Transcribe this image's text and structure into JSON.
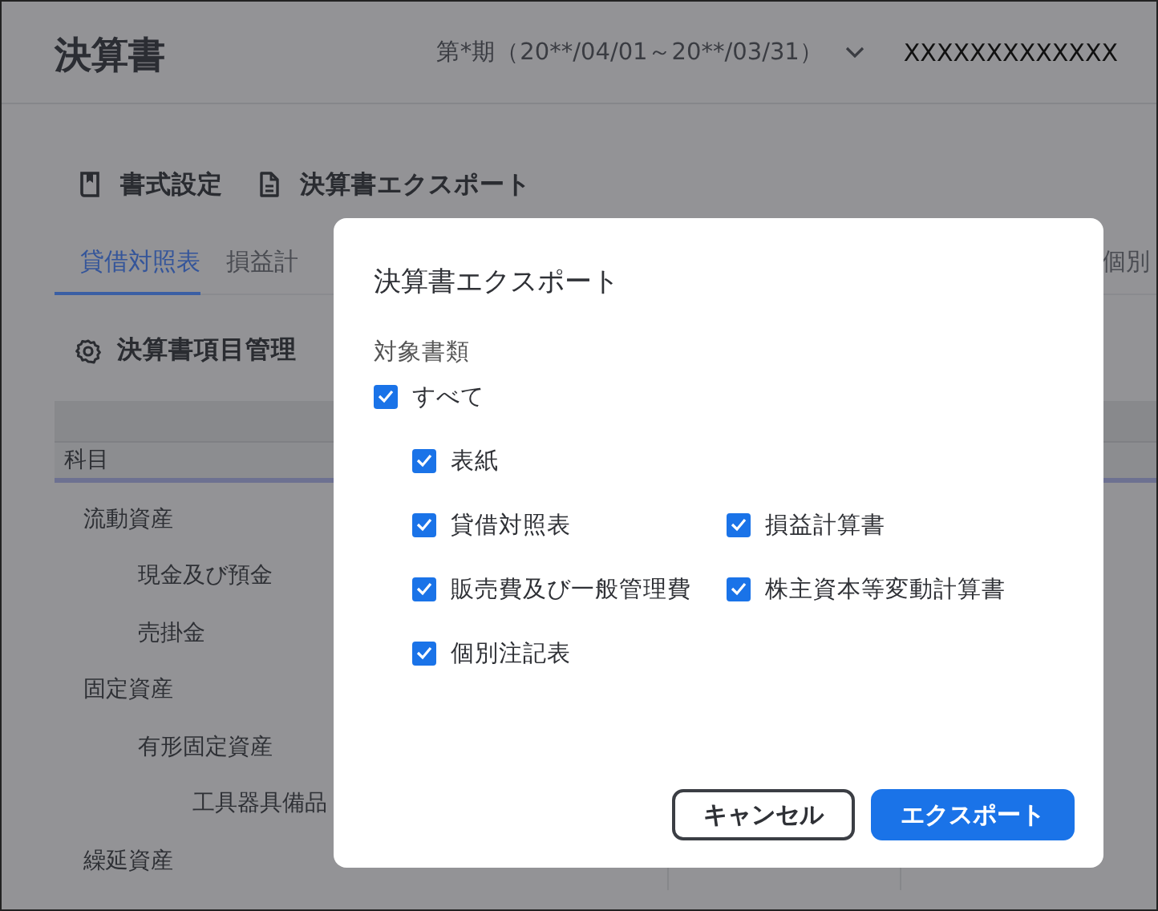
{
  "header": {
    "title": "決算書",
    "period": "第*期（20**/04/01～20**/03/31）",
    "user": "XXXXXXXXXXXXX"
  },
  "toolbar": [
    {
      "label": "書式設定"
    },
    {
      "label": "決算書エクスポート"
    }
  ],
  "tabs": [
    {
      "label": "貸借対照表",
      "selected": true
    },
    {
      "label": "損益計",
      "selected": false
    },
    {
      "label": "個別",
      "selected": false
    }
  ],
  "manage": {
    "label": "決算書項目管理"
  },
  "table": {
    "columns": [
      "科目"
    ],
    "rows": [
      {
        "name": "流動資産",
        "children": [
          {
            "name": "現金及び預金"
          },
          {
            "name": "売掛金"
          }
        ]
      },
      {
        "name": "固定資産",
        "children": [
          {
            "name": "有形固定資産",
            "children": [
              {
                "name": "工具器具備品"
              }
            ]
          }
        ]
      },
      {
        "name": "繰延資産"
      }
    ]
  },
  "dialog": {
    "title": "決算書エクスポート",
    "section_label": "対象書類",
    "all": {
      "label": "すべて",
      "checked": true
    },
    "rows": [
      {
        "items": [
          {
            "label": "表紙",
            "checked": true
          }
        ]
      },
      {
        "items": [
          {
            "label": "貸借対照表",
            "checked": true
          },
          {
            "label": "損益計算書",
            "checked": true
          }
        ]
      },
      {
        "items": [
          {
            "label": "販売費及び一般管理費",
            "checked": true
          },
          {
            "label": "株主資本等変動計算書",
            "checked": true
          }
        ]
      },
      {
        "items": [
          {
            "label": "個別注記表",
            "checked": true
          }
        ]
      }
    ],
    "buttons": [
      {
        "label": "キャンセル",
        "kind": "secondary"
      },
      {
        "label": "エクスポート",
        "kind": "primary"
      }
    ]
  }
}
